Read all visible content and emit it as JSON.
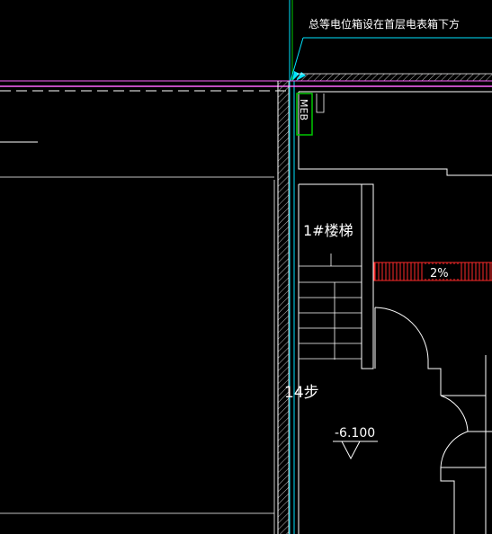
{
  "drawing": {
    "note": "总等电位箱设在首层电表箱下方",
    "meb_label": "MEB",
    "stair_label": "1#楼梯",
    "slope_label": "2%",
    "steps_label": "14步",
    "level_label": "-6.100"
  },
  "colors": {
    "background": "#000000",
    "line": "#ffffff",
    "cyan": "#00e5ff",
    "green": "#00c800",
    "magenta": "#ff66ff",
    "red": "#ff2a2a"
  }
}
